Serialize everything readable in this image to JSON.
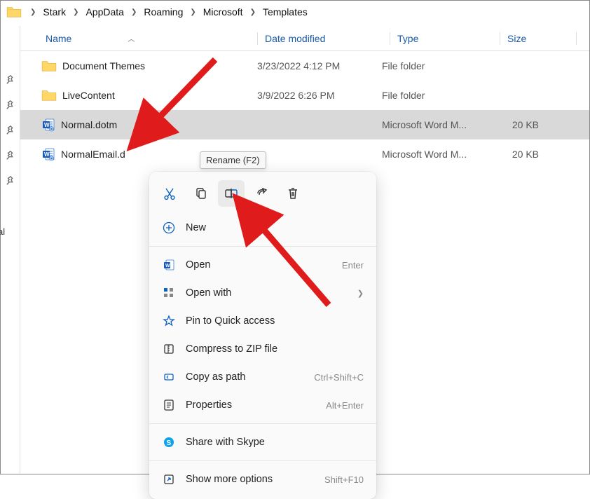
{
  "breadcrumb": [
    "Stark",
    "AppData",
    "Roaming",
    "Microsoft",
    "Templates"
  ],
  "columns": {
    "name": "Name",
    "date": "Date modified",
    "type": "Type",
    "size": "Size"
  },
  "nav_label_fragment": "al",
  "rows": [
    {
      "name": "Document Themes",
      "date": "3/23/2022 4:12 PM",
      "type": "File folder",
      "size": "",
      "icon": "folder",
      "selected": false
    },
    {
      "name": "LiveContent",
      "date": "3/9/2022 6:26 PM",
      "type": "File folder",
      "size": "",
      "icon": "folder",
      "selected": false
    },
    {
      "name": "Normal.dotm",
      "date": "",
      "type": "Microsoft Word M...",
      "size": "20 KB",
      "icon": "word",
      "selected": true
    },
    {
      "name": "NormalEmail.d",
      "date": "",
      "type": "Microsoft Word M...",
      "size": "20 KB",
      "icon": "word",
      "selected": false
    }
  ],
  "tooltip": "Rename (F2)",
  "menu": {
    "new": "New",
    "open": "Open",
    "open_accel": "Enter",
    "open_with": "Open with",
    "pin": "Pin to Quick access",
    "compress": "Compress to ZIP file",
    "copy_path": "Copy as path",
    "copy_path_accel": "Ctrl+Shift+C",
    "properties": "Properties",
    "properties_accel": "Alt+Enter",
    "skype": "Share with Skype",
    "more": "Show more options",
    "more_accel": "Shift+F10"
  }
}
